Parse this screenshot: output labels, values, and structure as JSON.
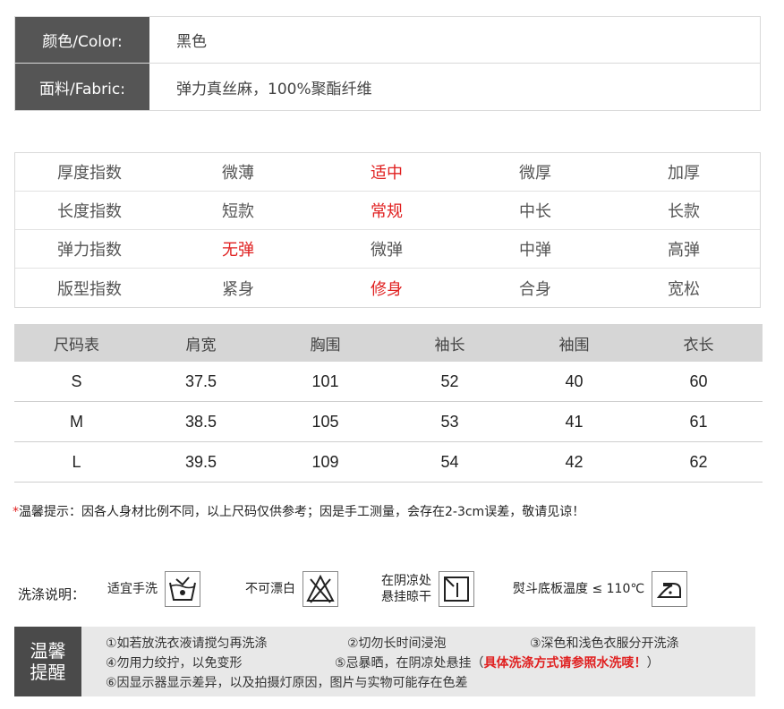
{
  "attributes": [
    {
      "label": "颜色/Color:",
      "value": "黑色"
    },
    {
      "label": "面料/Fabric:",
      "value": "弹力真丝麻，100%聚酯纤维"
    }
  ],
  "indices": [
    {
      "name": "厚度指数",
      "options": [
        "微薄",
        "适中",
        "微厚",
        "加厚"
      ],
      "selected": 1
    },
    {
      "name": "长度指数",
      "options": [
        "短款",
        "常规",
        "中长",
        "长款"
      ],
      "selected": 1
    },
    {
      "name": "弹力指数",
      "options": [
        "无弹",
        "微弹",
        "中弹",
        "高弹"
      ],
      "selected": 0
    },
    {
      "name": "版型指数",
      "options": [
        "紧身",
        "修身",
        "合身",
        "宽松"
      ],
      "selected": 1
    }
  ],
  "size_table": {
    "headers": [
      "尺码表",
      "肩宽",
      "胸围",
      "袖长",
      "袖围",
      "衣长"
    ],
    "rows": [
      [
        "S",
        "37.5",
        "101",
        "52",
        "40",
        "60"
      ],
      [
        "M",
        "38.5",
        "105",
        "53",
        "41",
        "61"
      ],
      [
        "L",
        "39.5",
        "109",
        "54",
        "42",
        "62"
      ]
    ]
  },
  "notice": {
    "star": "*",
    "text": "温馨提示：因各人身材比例不同，以上尺码仅供参考；因是手工测量，会存在2-3cm误差，敬请见谅！"
  },
  "wash": {
    "title": "洗涤说明：",
    "items": [
      {
        "text": "适宜手洗",
        "icon": "hand-wash-icon"
      },
      {
        "text": "不可漂白",
        "icon": "no-bleach-icon"
      },
      {
        "text_line1": "在阴凉处",
        "text_line2": "悬挂晾干",
        "icon": "line-dry-shade-icon"
      },
      {
        "text": "熨斗底板温度 ≤ 110℃",
        "icon": "iron-icon"
      }
    ]
  },
  "reminder": {
    "badge_line1": "温馨",
    "badge_line2": "提醒",
    "item1": "①如若放洗衣液请搅匀再洗涤",
    "item2": "②切勿长时间浸泡",
    "item3": "③深色和浅色衣服分开洗涤",
    "item4": "④勿用力绞拧，以免变形",
    "item5_prefix": "⑤忌暴晒，在阴凉处悬挂（",
    "item5_red": "具体洗涤方式请参照水洗唛！",
    "item5_suffix": "）",
    "item6": "⑥因显示器显示差异，以及拍摄灯原因，图片与实物可能存在色差"
  },
  "colors": {
    "label_bg": "#555555",
    "highlight_red": "#e02020",
    "size_header_bg": "#d6d6d6",
    "reminder_bg": "#e8e8e8",
    "badge_bg": "#4a4a4a"
  }
}
